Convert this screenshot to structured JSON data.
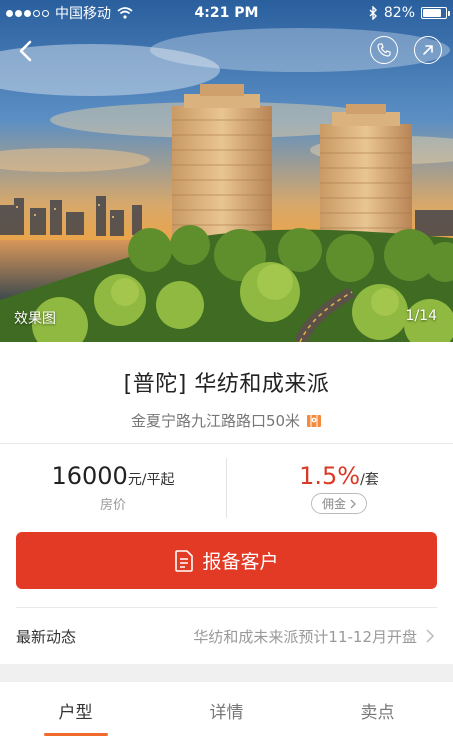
{
  "status_bar": {
    "carrier": "中国移动",
    "time": "4:21 PM",
    "battery_percent": "82%",
    "battery_level": 0.82,
    "icons": [
      "signal-dots",
      "wifi-icon",
      "bluetooth-icon",
      "battery-icon"
    ]
  },
  "hero": {
    "caption": "效果图",
    "counter": "1/14",
    "icons": [
      "back-arrow-icon",
      "phone-icon",
      "share-icon"
    ]
  },
  "property": {
    "title": "[普陀] 华纺和成来派",
    "address": "金夏宁路九江路路口50米",
    "address_icon": "map-pin-icon"
  },
  "price": {
    "value": "16000",
    "unit": "元/平起",
    "label": "房价"
  },
  "commission": {
    "value": "1.5%",
    "unit": "/套",
    "chip_label": "佣金",
    "color": "#d93a25"
  },
  "cta": {
    "label": "报备客户",
    "icon": "document-icon",
    "color": "#e23a25"
  },
  "news": {
    "label": "最新动态",
    "text": "华纺和成未来派预计11-12月开盘"
  },
  "tabs": [
    {
      "label": "户型",
      "active": true
    },
    {
      "label": "详情",
      "active": false
    },
    {
      "label": "卖点",
      "active": false
    }
  ],
  "accent_color": "#f06a2c"
}
